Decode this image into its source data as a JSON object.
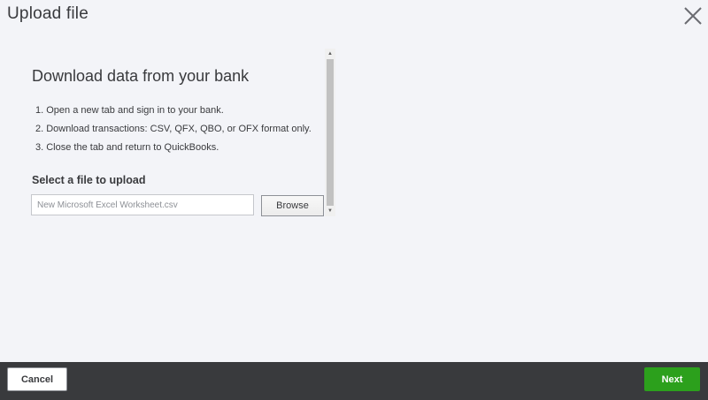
{
  "dialog": {
    "title": "Upload file",
    "close_icon": "close-icon"
  },
  "main": {
    "heading": "Download data from your bank",
    "steps": [
      "1. Open a new tab and sign in to your bank.",
      "2. Download transactions: CSV, QFX, QBO, or OFX format only.",
      "3. Close the tab and return to QuickBooks."
    ],
    "upload_label": "Select a file to upload",
    "file_input": {
      "value": "",
      "placeholder": "New Microsoft Excel Worksheet.csv"
    },
    "browse_label": "Browse"
  },
  "scrollbar": {
    "up_icon": "scroll-up-arrow-icon",
    "down_icon": "scroll-down-arrow-icon"
  },
  "footer": {
    "cancel_label": "Cancel",
    "next_label": "Next"
  },
  "colors": {
    "background": "#f3f4f8",
    "footer_background": "#393a3d",
    "primary_button": "#2ca01c",
    "text": "#393a3d"
  }
}
